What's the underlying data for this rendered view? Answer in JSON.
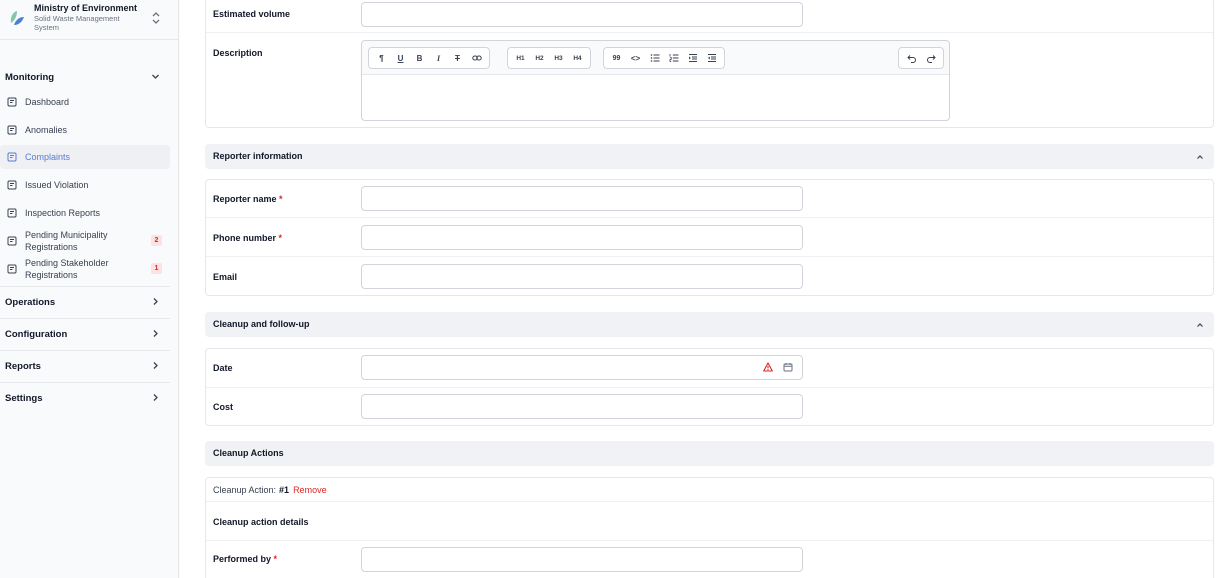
{
  "brand": {
    "title": "Ministry of Environment",
    "subtitle": "Solid Waste Management System",
    "logo_icon": "leaf-logo-icon",
    "switch_icon": "chevron-updown-icon"
  },
  "sidebar": {
    "monitoring": {
      "label": "Monitoring",
      "items": [
        {
          "label": "Dashboard"
        },
        {
          "label": "Anomalies"
        },
        {
          "label": "Complaints",
          "active": true
        },
        {
          "label": "Issued Violation"
        },
        {
          "label": "Inspection Reports"
        },
        {
          "label": "Pending Municipality Registrations",
          "badge": "2"
        },
        {
          "label": "Pending Stakeholder Registrations",
          "badge": "1"
        }
      ]
    },
    "groups": [
      {
        "label": "Operations"
      },
      {
        "label": "Configuration"
      },
      {
        "label": "Reports"
      },
      {
        "label": "Settings"
      }
    ]
  },
  "form": {
    "estimated_volume": {
      "label": "Estimated volume",
      "value": ""
    },
    "description": {
      "label": "Description",
      "toolbar": {
        "paragraph": "¶",
        "underline": "U",
        "bold": "B",
        "italic": "I",
        "strike": "T",
        "h1": "H1",
        "h2": "H2",
        "h3": "H3",
        "h4": "H4",
        "quote": "99",
        "code": "<>"
      },
      "value": ""
    },
    "reporter_section": {
      "title": "Reporter information",
      "name_label": "Reporter name",
      "phone_label": "Phone number",
      "email_label": "Email",
      "required_mark": "*"
    },
    "cleanup_section": {
      "title": "Cleanup and follow-up",
      "date_label": "Date",
      "cost_label": "Cost"
    },
    "cleanup_actions": {
      "title": "Cleanup Actions",
      "item_prefix": "Cleanup Action:",
      "item_number": "#1",
      "remove_label": "Remove",
      "details_label": "Cleanup action details",
      "performed_by_label": "Performed by"
    }
  },
  "colors": {
    "accent": "#5b7bd5",
    "danger": "#dc2626",
    "section_bg": "#f1f2f5"
  }
}
